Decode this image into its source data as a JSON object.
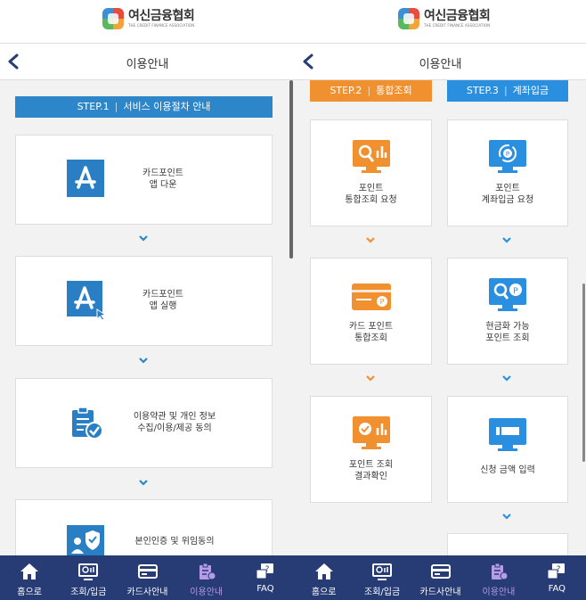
{
  "logo": {
    "name": "여신금융협회",
    "tagline": "THE CREDIT FINANCE ASSOCIATION"
  },
  "left": {
    "header_title": "이용안내",
    "step": {
      "number": "STEP.1",
      "separator": "|",
      "label": "서비스 이용절차 안내",
      "color": "#2d86c9"
    },
    "cards": [
      {
        "icon": "app-store-icon",
        "lines": [
          "카드포인트",
          "앱 다운"
        ]
      },
      {
        "icon": "app-launch-icon",
        "lines": [
          "카드포인트",
          "앱 실행"
        ]
      },
      {
        "icon": "clipboard-check-icon",
        "lines": [
          "이용약관 및 개인 정보",
          "수집/이용/제공 동의"
        ]
      },
      {
        "icon": "identity-shield-icon",
        "lines": [
          "본인인증 및 위임동의"
        ]
      }
    ]
  },
  "right": {
    "header_title": "이용안내",
    "step2": {
      "number": "STEP.2",
      "separator": "|",
      "label": "통합조회",
      "color": "#f0902f"
    },
    "step3": {
      "number": "STEP.3",
      "separator": "|",
      "label": "계좌입금",
      "color": "#2b8fe0"
    },
    "col_step2": [
      {
        "icon": "search-monitor-icon",
        "lines": [
          "포인트",
          "통합조회 요청"
        ]
      },
      {
        "icon": "credit-card-point-icon",
        "lines": [
          "카드 포인트",
          "통합조회"
        ]
      },
      {
        "icon": "check-monitor-icon",
        "lines": [
          "포인트 조회",
          "결과확인"
        ]
      }
    ],
    "col_step3": [
      {
        "icon": "point-refresh-monitor-icon",
        "lines": [
          "포인트",
          "계좌입금 요청"
        ]
      },
      {
        "icon": "point-search-monitor-icon",
        "lines": [
          "현금화 가능",
          "포인트 조회"
        ]
      },
      {
        "icon": "amount-input-monitor-icon",
        "lines": [
          "신청 금액 입력"
        ]
      }
    ]
  },
  "tabbar": {
    "items": [
      {
        "label": "홈으로",
        "icon": "home-icon"
      },
      {
        "label": "조회/입금",
        "icon": "search-deposit-icon"
      },
      {
        "label": "카드사안내",
        "icon": "card-info-icon"
      },
      {
        "label": "이용안내",
        "icon": "guide-icon",
        "active": true
      },
      {
        "label": "FAQ",
        "icon": "faq-icon"
      }
    ],
    "active_color": "#b59be8",
    "background": "#273b75"
  }
}
